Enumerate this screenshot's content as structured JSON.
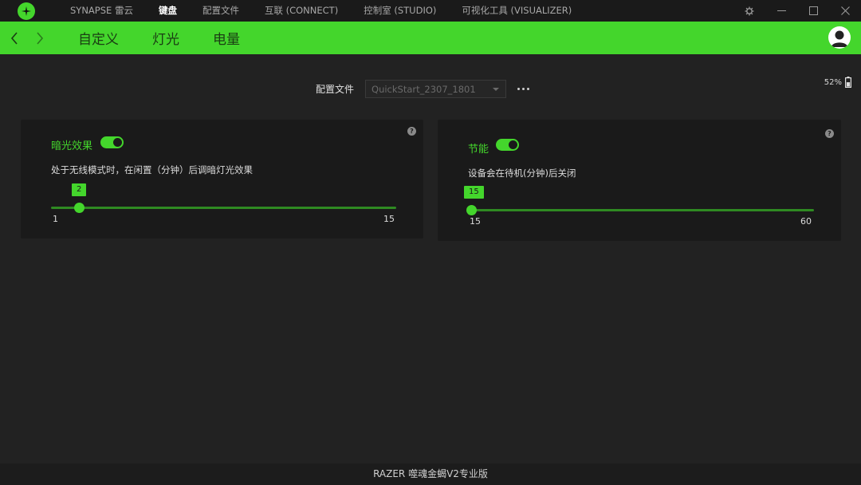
{
  "topnav": {
    "tabs": [
      {
        "label": "SYNAPSE 雷云"
      },
      {
        "label": "键盘"
      },
      {
        "label": "配置文件"
      },
      {
        "label": "互联 (CONNECT)"
      },
      {
        "label": "控制室 (STUDIO)"
      },
      {
        "label": "可视化工具 (VISUALIZER)"
      }
    ],
    "active_index": 1
  },
  "subnav": {
    "tabs": [
      {
        "label": "自定义"
      },
      {
        "label": "灯光"
      },
      {
        "label": "电量"
      }
    ]
  },
  "profile": {
    "label": "配置文件",
    "selected": "QuickStart_2307_1801"
  },
  "battery": {
    "percent_text": "52%",
    "level": 0.52
  },
  "dimming_card": {
    "title": "暗光效果",
    "toggle_on": true,
    "description": "处于无线模式时，在闲置（分钟）后调暗灯光效果",
    "slider": {
      "value": "2",
      "min": "1",
      "max": "15"
    },
    "help": "?"
  },
  "power_card": {
    "title": "节能",
    "toggle_on": true,
    "description": "设备会在待机(分钟)后关闭",
    "slider": {
      "value": "15",
      "min": "15",
      "max": "60"
    },
    "help": "?"
  },
  "footer": {
    "device_name": "RAZER 噬魂金蝎V2专业版"
  },
  "colors": {
    "accent": "#44d62c",
    "background": "#222222",
    "card": "#1a1a1a"
  }
}
